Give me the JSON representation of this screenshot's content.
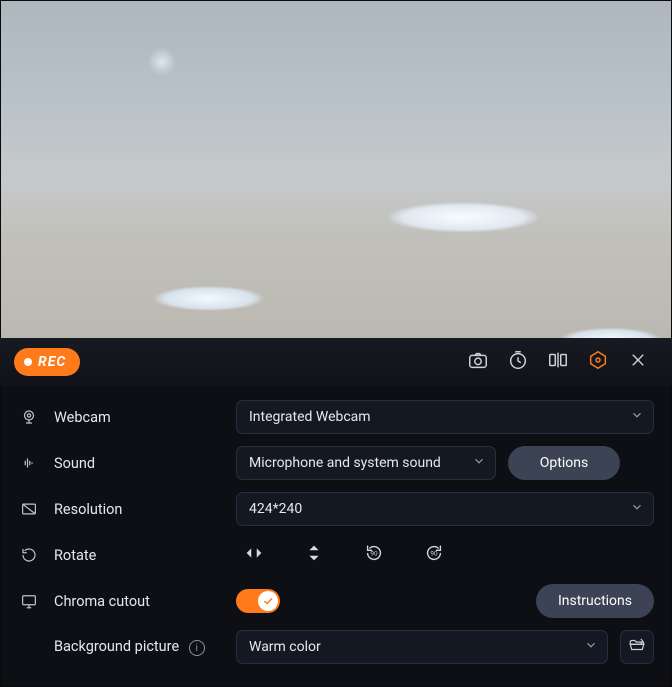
{
  "toolbar": {
    "rec_label": "REC"
  },
  "labels": {
    "webcam": "Webcam",
    "sound": "Sound",
    "resolution": "Resolution",
    "rotate": "Rotate",
    "chroma": "Chroma cutout",
    "background": "Background picture"
  },
  "webcam": {
    "selected": "Integrated Webcam"
  },
  "sound": {
    "selected": "Microphone and system sound",
    "options_label": "Options"
  },
  "resolution": {
    "selected": "424*240"
  },
  "chroma": {
    "on": true,
    "instructions_label": "Instructions"
  },
  "background": {
    "selected": "Warm color"
  }
}
